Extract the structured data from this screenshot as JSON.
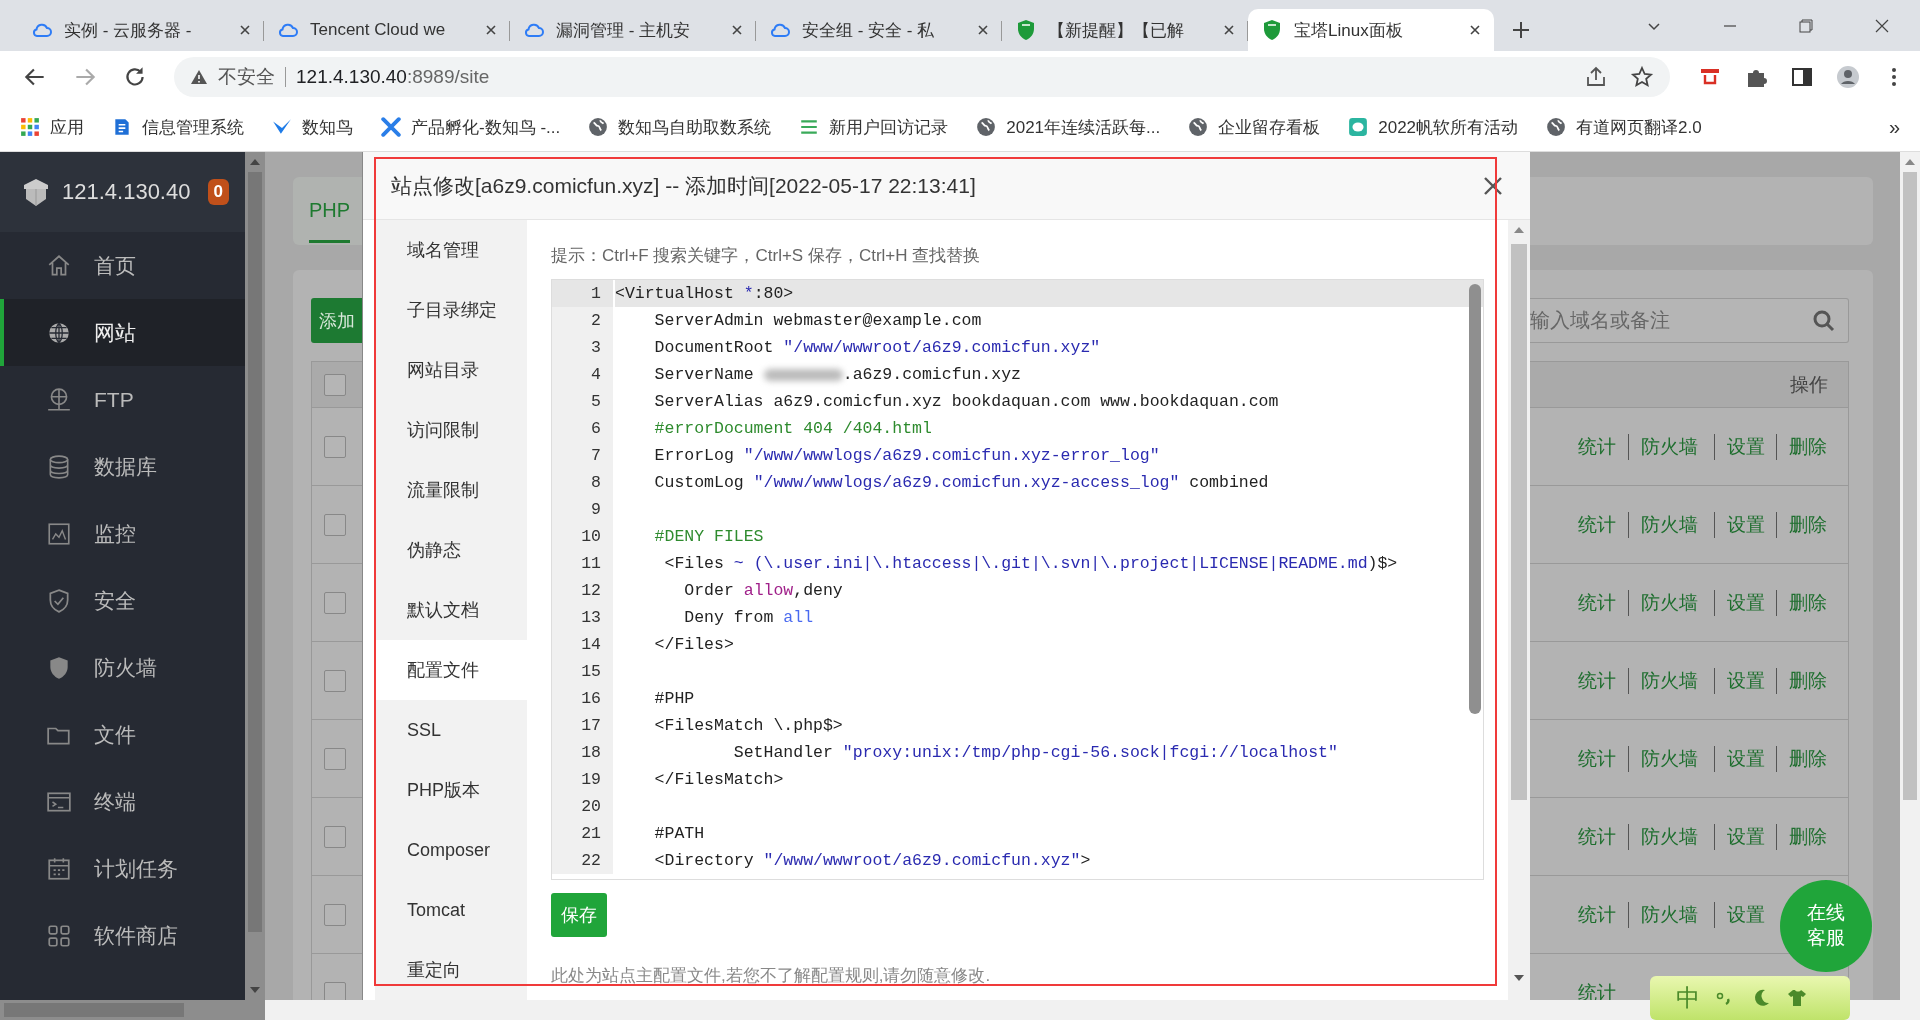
{
  "browser": {
    "tabs": [
      {
        "title": "实例 - 云服务器 -",
        "kind": "cloud",
        "selected": false
      },
      {
        "title": "Tencent Cloud we",
        "kind": "cloud",
        "selected": false
      },
      {
        "title": "漏洞管理 - 主机安",
        "kind": "cloud",
        "selected": false
      },
      {
        "title": "安全组 - 安全 - 私",
        "kind": "cloud",
        "selected": false
      },
      {
        "title": "【新提醒】【已解",
        "kind": "shield",
        "selected": false
      },
      {
        "title": "宝塔Linux面板",
        "kind": "shield",
        "selected": true
      }
    ],
    "security": "不安全",
    "url_host": "121.4.130.40",
    "url_path": ":8989/site",
    "bookmarks": [
      {
        "label": "应用",
        "kind": "apps"
      },
      {
        "label": "信息管理系统",
        "kind": "doc"
      },
      {
        "label": "数知鸟",
        "kind": "bird"
      },
      {
        "label": "产品孵化-数知鸟 -...",
        "kind": "flow"
      },
      {
        "label": "数知鸟自助取数系统",
        "kind": "globe"
      },
      {
        "label": "新用户回访记录",
        "kind": "list"
      },
      {
        "label": "2021年连续活跃每...",
        "kind": "globe"
      },
      {
        "label": "企业留存看板",
        "kind": "globe"
      },
      {
        "label": "2022帆软所有活动",
        "kind": "chat"
      },
      {
        "label": "有道网页翻译2.0",
        "kind": "globe"
      }
    ],
    "bookmarks_more": "»"
  },
  "sidebar": {
    "server": "121.4.130.40",
    "badge": "0",
    "items": [
      {
        "label": "首页",
        "selected": false
      },
      {
        "label": "网站",
        "selected": true
      },
      {
        "label": "FTP",
        "selected": false
      },
      {
        "label": "数据库",
        "selected": false
      },
      {
        "label": "监控",
        "selected": false
      },
      {
        "label": "安全",
        "selected": false
      },
      {
        "label": "防火墙",
        "selected": false
      },
      {
        "label": "文件",
        "selected": false
      },
      {
        "label": "终端",
        "selected": false
      },
      {
        "label": "计划任务",
        "selected": false
      },
      {
        "label": "软件商店",
        "selected": false
      }
    ]
  },
  "page": {
    "tab": "PHP",
    "add_button": "添加",
    "search": {
      "placeholder": "输入域名或备注"
    },
    "header_checked": false,
    "actions_header": "操作",
    "rows": [
      {
        "checked": false,
        "links": [
          "统计",
          "防火墙",
          "设置",
          "删除"
        ]
      },
      {
        "checked": false,
        "links": [
          "统计",
          "防火墙",
          "设置",
          "删除"
        ]
      },
      {
        "checked": false,
        "links": [
          "统计",
          "防火墙",
          "设置",
          "删除"
        ]
      },
      {
        "checked": false,
        "links": [
          "统计",
          "防火墙",
          "设置",
          "删除"
        ]
      },
      {
        "checked": false,
        "links": [
          "统计",
          "防火墙",
          "设置",
          "删除"
        ]
      },
      {
        "checked": false,
        "links": [
          "统计",
          "防火墙",
          "设置",
          "删除"
        ]
      },
      {
        "checked": false,
        "links": [
          "统计",
          "防火墙",
          "设置"
        ]
      },
      {
        "checked": false,
        "links": [
          "统计"
        ]
      }
    ]
  },
  "dialog": {
    "title": "站点修改[a6z9.comicfun.xyz] -- 添加时间[2022-05-17 22:13:41]",
    "menu": [
      {
        "label": "域名管理",
        "selected": false
      },
      {
        "label": "子目录绑定",
        "selected": false
      },
      {
        "label": "网站目录",
        "selected": false
      },
      {
        "label": "访问限制",
        "selected": false
      },
      {
        "label": "流量限制",
        "selected": false
      },
      {
        "label": "伪静态",
        "selected": false
      },
      {
        "label": "默认文档",
        "selected": false
      },
      {
        "label": "配置文件",
        "selected": true
      },
      {
        "label": "SSL",
        "selected": false
      },
      {
        "label": "PHP版本",
        "selected": false
      },
      {
        "label": "Composer",
        "selected": false
      },
      {
        "label": "Tomcat",
        "selected": false
      },
      {
        "label": "重定向",
        "selected": false
      }
    ],
    "hint": "提示：Ctrl+F 搜索关键字，Ctrl+S 保存，Ctrl+H 查找替换",
    "lines": [
      {
        "number": "1",
        "current": true,
        "tokens": [
          {
            "text": "<VirtualHost ",
            "kind": "plain"
          },
          {
            "text": "*",
            "kind": "operator"
          },
          {
            "text": ":80>",
            "kind": "plain"
          }
        ]
      },
      {
        "number": "2",
        "current": false,
        "tokens": [
          {
            "text": "    ServerAdmin webmaster@example.com",
            "kind": "plain"
          }
        ]
      },
      {
        "number": "3",
        "current": false,
        "tokens": [
          {
            "text": "    DocumentRoot ",
            "kind": "plain"
          },
          {
            "text": "\"/www/wwwroot/a6z9.comicfun.xyz\"",
            "kind": "string"
          }
        ]
      },
      {
        "number": "4",
        "current": false,
        "tokens": [
          {
            "text": "    ServerName ",
            "kind": "plain"
          },
          {
            "kind": "redacted"
          },
          {
            "text": ".a6z9.comicfun.xyz",
            "kind": "plain"
          }
        ]
      },
      {
        "number": "5",
        "current": false,
        "tokens": [
          {
            "text": "    ServerAlias a6z9.comicfun.xyz bookdaquan.com www.bookdaquan.com",
            "kind": "plain"
          }
        ]
      },
      {
        "number": "6",
        "current": false,
        "tokens": [
          {
            "text": "    #errorDocument 404 /404.html",
            "kind": "comment"
          }
        ]
      },
      {
        "number": "7",
        "current": false,
        "tokens": [
          {
            "text": "    ErrorLog ",
            "kind": "plain"
          },
          {
            "text": "\"/www/wwwlogs/a6z9.comicfun.xyz-error_log\"",
            "kind": "string"
          }
        ]
      },
      {
        "number": "8",
        "current": false,
        "tokens": [
          {
            "text": "    CustomLog ",
            "kind": "plain"
          },
          {
            "text": "\"/www/wwwlogs/a6z9.comicfun.xyz-access_log\"",
            "kind": "string"
          },
          {
            "text": " combined",
            "kind": "plain"
          }
        ]
      },
      {
        "number": "9",
        "current": false
      },
      {
        "number": "10",
        "current": false,
        "tokens": [
          {
            "text": "    #DENY FILES",
            "kind": "comment"
          }
        ]
      },
      {
        "number": "11",
        "current": false,
        "tokens": [
          {
            "text": "     <Files ",
            "kind": "plain"
          },
          {
            "text": "~ (\\.user.ini|\\.htaccess|\\.git|\\.svn|\\.project|LICENSE|README.md",
            "kind": "operator"
          },
          {
            "text": ")$>",
            "kind": "plain"
          }
        ]
      },
      {
        "number": "12",
        "current": false,
        "tokens": [
          {
            "text": "       Order ",
            "kind": "plain"
          },
          {
            "text": "allow",
            "kind": "keyword"
          },
          {
            "text": ",deny",
            "kind": "plain"
          }
        ]
      },
      {
        "number": "13",
        "current": false,
        "tokens": [
          {
            "text": "       Deny from ",
            "kind": "plain"
          },
          {
            "text": "all",
            "kind": "atom"
          }
        ]
      },
      {
        "number": "14",
        "current": false,
        "tokens": [
          {
            "text": "    </Files>",
            "kind": "plain"
          }
        ]
      },
      {
        "number": "15",
        "current": false
      },
      {
        "number": "16",
        "current": false,
        "tokens": [
          {
            "text": "    #PHP",
            "kind": "plain"
          }
        ]
      },
      {
        "number": "17",
        "current": false,
        "tokens": [
          {
            "text": "    <FilesMatch \\.php$>",
            "kind": "plain"
          }
        ]
      },
      {
        "number": "18",
        "current": false,
        "tokens": [
          {
            "text": "            SetHandler ",
            "kind": "plain"
          },
          {
            "text": "\"proxy:unix:/tmp/php-cgi-56.sock|fcgi://localhost\"",
            "kind": "string"
          }
        ]
      },
      {
        "number": "19",
        "current": false,
        "tokens": [
          {
            "text": "    </FilesMatch>",
            "kind": "plain"
          }
        ]
      },
      {
        "number": "20",
        "current": false
      },
      {
        "number": "21",
        "current": false,
        "tokens": [
          {
            "text": "    #PATH",
            "kind": "plain"
          }
        ]
      },
      {
        "number": "22",
        "current": false,
        "tokens": [
          {
            "text": "    <Directory ",
            "kind": "plain"
          },
          {
            "text": "\"/www/wwwroot/a6z9.comicfun.xyz\"",
            "kind": "string"
          },
          {
            "text": ">",
            "kind": "plain"
          }
        ]
      }
    ],
    "save_button": "保存",
    "note": "此处为站点主配置文件,若您不了解配置规则,请勿随意修改."
  },
  "chat_button": "在线客服",
  "ime": {
    "mode": "中"
  }
}
